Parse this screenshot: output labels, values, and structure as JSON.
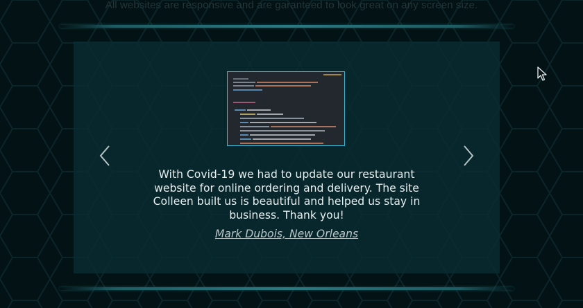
{
  "intro": {
    "text": "All websites are responsive and are garanteed to look great on any screen size."
  },
  "testimonial": {
    "quote": "With Covid-19 we had to update our restaurant website for online ordering and delivery. The site Colleen built us is beautiful and helped us stay in business. Thank you!",
    "author": "Mark Dubois, New Orleans"
  },
  "controls": {
    "prev_icon": "chevron-left-icon",
    "next_icon": "chevron-right-icon"
  },
  "colors": {
    "background": "#031214",
    "panel": "#0a2c32",
    "accent": "#3fb6d1"
  }
}
